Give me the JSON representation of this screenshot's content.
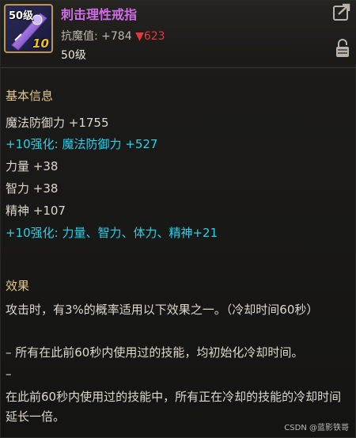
{
  "item": {
    "level_tag": "50级",
    "enhance_tag": "10",
    "name": "刺击理性戒指",
    "resist_label": "抗魔值:",
    "resist_value": "+784",
    "resist_down": "▼623",
    "level": "50级",
    "icon": "ring-item-icon"
  },
  "colors": {
    "name": "#cf6ee8",
    "section": "#e0c88a",
    "enhance": "#2ad0e8",
    "down": "#e23a3a"
  },
  "basic": {
    "heading": "基本信息",
    "magic_def": "魔法防御力 +1755",
    "enh_magic_def": "+10强化: 魔法防御力 +527",
    "str": "力量 +38",
    "int": "智力 +38",
    "spirit": "精神 +107",
    "enh_stats": "+10强化: 力量、智力、体力、精神+21"
  },
  "effect": {
    "heading": "效果",
    "p1": "攻击时，有3%的概率适用以下效果之一。（冷却时间60秒）",
    "p2": "– 所有在此前60秒内使用过的技能，均初始化冷却时间。",
    "p3": "–",
    "p4": "在此前60秒内使用过的技能中，所有正在冷却的技能的冷却时间延长一倍。"
  },
  "watermark": "CSDN @蓝影铁哥"
}
